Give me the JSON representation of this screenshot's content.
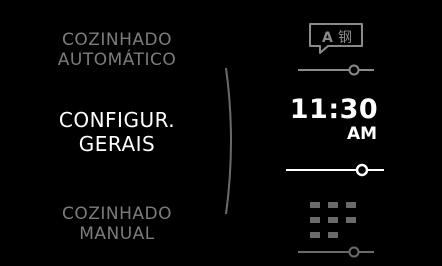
{
  "menu": {
    "items": [
      {
        "line1": "COZINHADO",
        "line2": "AUTOMÁTICO",
        "state": "inactive"
      },
      {
        "line1": "CONFIGUR.",
        "line2": "GERAIS",
        "state": "selected"
      },
      {
        "line1": "COZINHADO",
        "line2": "MANUAL",
        "state": "inactive"
      }
    ]
  },
  "preview": {
    "language_icon": {
      "name": "language-icon",
      "latin_glyph": "A",
      "cjk_glyph": "钢"
    },
    "clock": {
      "time": "11:30",
      "meridiem": "AM"
    },
    "manual_icon": {
      "name": "grid-icon"
    }
  },
  "colors": {
    "background": "#000000",
    "text_active": "#ffffff",
    "text_inactive": "#7c7c7c"
  }
}
